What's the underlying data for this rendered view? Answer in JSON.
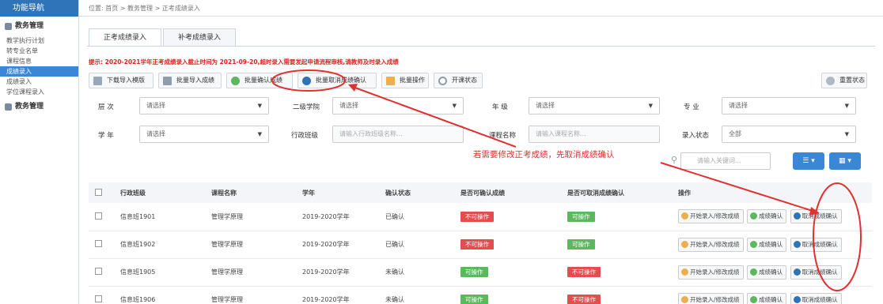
{
  "sidebar": {
    "brand": "功能导航",
    "sections": [
      {
        "label": "教务管理",
        "items": [
          "教学执行计划",
          "转专业名单",
          "课程信息",
          "成绩录入",
          "成绩录入",
          "学位课程录入"
        ]
      },
      {
        "label": "教务管理"
      }
    ],
    "active_index": 3
  },
  "breadcrumb": "位置: 首页 > 教务管理 > 正考成绩录入",
  "tabs": [
    "正考成绩录入",
    "补考成绩录入"
  ],
  "notice": "提示: 2020-2021学年正考成绩录入截止时间为 2021-09-20,超时录入需要发起申请流程审核,请教师及时录入成绩",
  "toolbar": {
    "buttons": [
      "下载导入模版",
      "批量导入成绩",
      "批量确认成绩",
      "批量取消成绩确认",
      "批量操作",
      "开课状态"
    ],
    "right_button": "重置状态"
  },
  "filters": {
    "row1": [
      {
        "label": "层 次",
        "value": "请选择"
      },
      {
        "label": "二级学院",
        "value": "请选择"
      },
      {
        "label": "年 级",
        "value": "请选择"
      },
      {
        "label": "专 业",
        "value": "请选择"
      }
    ],
    "row2": [
      {
        "label": "学 年",
        "value": "请选择"
      },
      {
        "label": "行政班级",
        "placeholder": "请输入行政班级名称..."
      },
      {
        "label": "课程名称",
        "placeholder": "请输入课程名称..."
      },
      {
        "label": "录入状态",
        "value": "全部"
      }
    ]
  },
  "search": {
    "placeholder": "请输入关键词..."
  },
  "table": {
    "headers": [
      "行政班级",
      "课程名称",
      "学年",
      "确认状态",
      "是否可确认成绩",
      "是否可取消成绩确认",
      "操作"
    ],
    "rows": [
      {
        "class": "信息班1901",
        "course": "管理学原理",
        "year": "2019-2020学年",
        "status": "已确认",
        "can_confirm": "不可操作",
        "can_cancel": "可操作"
      },
      {
        "class": "信息班1902",
        "course": "管理学原理",
        "year": "2019-2020学年",
        "status": "已确认",
        "can_confirm": "不可操作",
        "can_cancel": "可操作"
      },
      {
        "class": "信息班1905",
        "course": "管理学原理",
        "year": "2019-2020学年",
        "status": "未确认",
        "can_confirm": "可操作",
        "can_cancel": "不可操作"
      },
      {
        "class": "信息班1906",
        "course": "管理学原理",
        "year": "2019-2020学年",
        "status": "未确认",
        "can_confirm": "可操作",
        "can_cancel": "不可操作"
      }
    ],
    "actions": [
      "开始录入/修改成绩",
      "成绩确认",
      "取消成绩确认"
    ]
  },
  "annotation": {
    "text": "若需要修改正考成绩，先取消成绩确认",
    "color": "#e03030"
  },
  "colors": {
    "primary": "#2f73b9",
    "danger": "#e44d4d",
    "success": "#5cb85c",
    "annotation": "#e03030"
  }
}
